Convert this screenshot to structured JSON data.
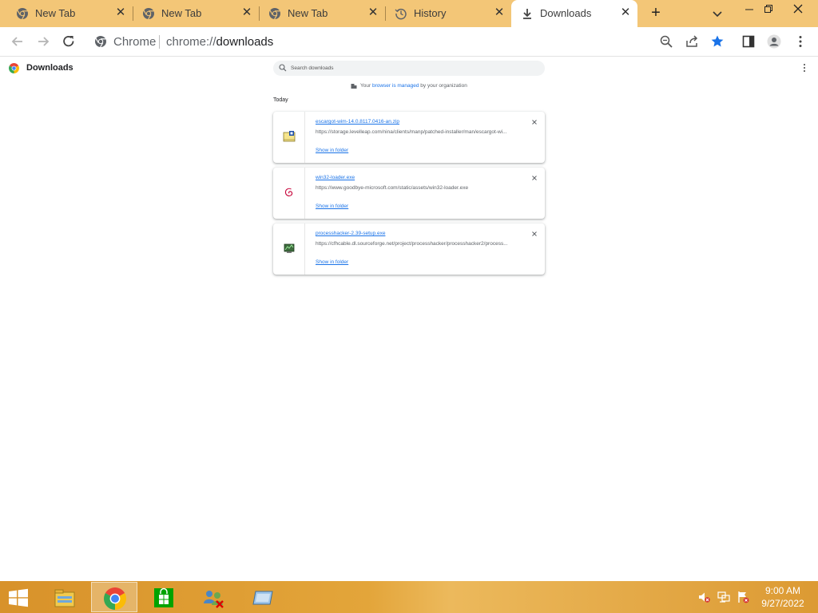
{
  "tabs": [
    {
      "title": "New Tab",
      "icon": "chrome-icon"
    },
    {
      "title": "New Tab",
      "icon": "chrome-icon"
    },
    {
      "title": "New Tab",
      "icon": "chrome-icon"
    },
    {
      "title": "History",
      "icon": "history-icon"
    },
    {
      "title": "Downloads",
      "icon": "download-icon",
      "active": true
    }
  ],
  "omnibox": {
    "site_label": "Chrome",
    "url_scheme": "chrome://",
    "url_host": "downloads"
  },
  "page": {
    "title": "Downloads",
    "search_placeholder": "Search downloads",
    "managed_prefix": "Your",
    "managed_link": "browser is managed",
    "managed_suffix": "by your organization",
    "date_header": "Today"
  },
  "downloads": [
    {
      "filename": "escargot-wim-14.0.8117.0416-an.zip",
      "url": "https://storage.levelleap.com/nina/clients/manp/patched-installer/man/escargot-wi...",
      "action": "Show in folder",
      "icon": "zip-archive-icon"
    },
    {
      "filename": "win32-loader.exe",
      "url": "https://www.goodbye-microsoft.com/static/assets/win32-loader.exe",
      "action": "Show in folder",
      "icon": "debian-swirl-icon"
    },
    {
      "filename": "processhacker-2.39-setup.exe",
      "url": "https://cfhcable.dl.sourceforge.net/project/processhacker/processhacker2/process...",
      "action": "Show in folder",
      "icon": "process-hacker-icon"
    }
  ],
  "taskbar": {
    "apps": [
      "file-explorer-icon",
      "chrome-icon",
      "store-icon",
      "network-people-icon",
      "remote-desktop-icon"
    ],
    "clock_time": "9:00 AM",
    "clock_date": "9/27/2022"
  },
  "colors": {
    "tabstrip": "#f3c677",
    "link": "#1a73e8",
    "taskbar": "#e3a53a"
  }
}
